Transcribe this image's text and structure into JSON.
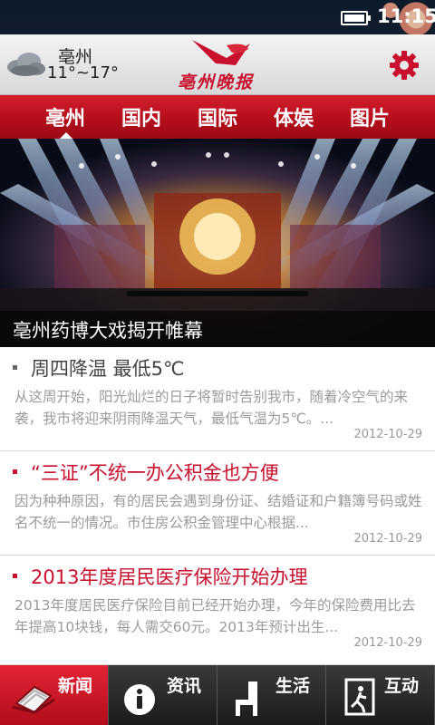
{
  "status_bar": {
    "time": "11:15"
  },
  "header": {
    "city": "亳州",
    "temperature": "11°~17°",
    "logo_text": "亳州晚报",
    "weather_icon": "cloud-icon",
    "settings_icon": "gear-icon",
    "brand_color": "#c8102e"
  },
  "tabs": [
    {
      "label": "亳州",
      "active": true
    },
    {
      "label": "国内",
      "active": false
    },
    {
      "label": "国际",
      "active": false
    },
    {
      "label": "体娱",
      "active": false
    },
    {
      "label": "图片",
      "active": false
    }
  ],
  "hero": {
    "caption": "亳州药博大戏揭开帷幕"
  },
  "news": [
    {
      "title": "周四降温 最低5℃",
      "summary": "从这周开始，阳光灿烂的日子将暂时告别我市，随着冷空气的来袭，我市将迎来阴雨降温天气，最低气温为5℃。...",
      "date": "2012-10-29"
    },
    {
      "title": "“三证”不统一办公积金也方便",
      "summary": "因为种种原因，有的居民会遇到身份证、结婚证和户籍簿号码或姓名不统一的情况。市住房公积金管理中心根据...",
      "date": "2012-10-29"
    },
    {
      "title": "2013年度居民医疗保险开始办理",
      "summary": "2013年度居民医疗保险目前已经开始办理，今年的保险费用比去年提高10块钱，每人需交60元。2013年预计出生...",
      "date": "2012-10-29"
    }
  ],
  "bottom_nav": [
    {
      "label": "新闻",
      "icon": "newspaper-icon",
      "active": true
    },
    {
      "label": "资讯",
      "icon": "info-icon",
      "active": false
    },
    {
      "label": "生活",
      "icon": "chair-icon",
      "active": false
    },
    {
      "label": "互动",
      "icon": "exit-door-icon",
      "active": false
    }
  ]
}
